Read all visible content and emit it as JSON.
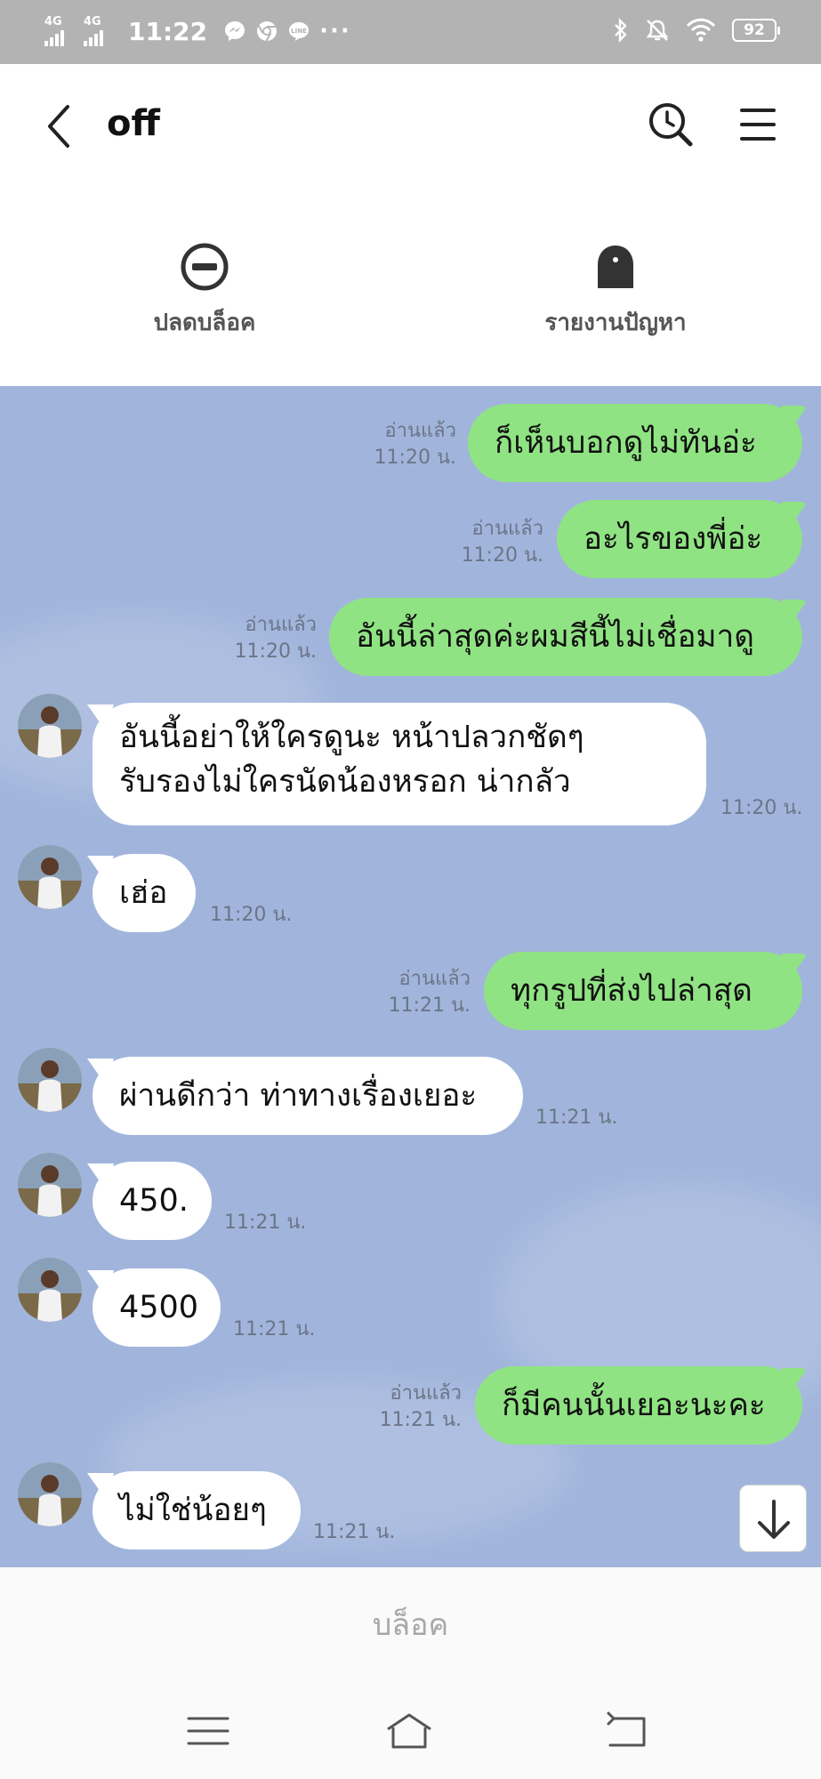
{
  "status_bar": {
    "network_1": "4G",
    "network_2": "4G",
    "time": "11:22",
    "more": "···",
    "battery": "92",
    "icons": [
      "messenger-icon",
      "chrome-icon",
      "line-icon",
      "bluetooth-icon",
      "mute-icon",
      "wifi-icon"
    ]
  },
  "header": {
    "title": "off",
    "back_icon": "chevron-left-icon",
    "search_icon": "search-history-icon",
    "menu_icon": "hamburger-icon"
  },
  "actions": {
    "unblock": "ปลดบล็อค",
    "report": "รายงานปัญหา"
  },
  "messages": [
    {
      "dir": "out",
      "text": "ก็เห็นบอกดูไม่ทันอ่ะ",
      "read": "อ่านแล้ว",
      "time": "11:20 น."
    },
    {
      "dir": "out",
      "text": "อะไรของพี่อ่ะ",
      "read": "อ่านแล้ว",
      "time": "11:20 น."
    },
    {
      "dir": "out",
      "text": "อันนี้ล่าสุดค่ะผมสีนี้ไม่เชื่อมาดู",
      "read": "อ่านแล้ว",
      "time": "11:20 น."
    },
    {
      "dir": "in",
      "lines": [
        "อันนี้อย่าให้ใครดูนะ หน้าปลวกชัดๆ",
        "รับรองไม่ใครนัดน้องหรอก น่ากลัว"
      ],
      "time": "11:20 น."
    },
    {
      "dir": "in",
      "text": "เฮ่อ",
      "time": "11:20 น."
    },
    {
      "dir": "out",
      "text": "ทุกรูปที่ส่งไปล่าสุด",
      "read": "อ่านแล้ว",
      "time": "11:21 น."
    },
    {
      "dir": "in",
      "text": "ผ่านดีกว่า ท่าทางเรื่องเยอะ",
      "time": "11:21 น."
    },
    {
      "dir": "in",
      "text": "450.",
      "time": "11:21 น."
    },
    {
      "dir": "in",
      "text": "4500",
      "time": "11:21 น."
    },
    {
      "dir": "out",
      "text": "ก็มีคนนั้นเยอะนะคะ",
      "read": "อ่านแล้ว",
      "time": "11:21 น."
    },
    {
      "dir": "in",
      "text": "ไม่ใช่น้อยๆ",
      "time": "11:21 น."
    }
  ],
  "bottom": {
    "block_label": "บล็อค"
  },
  "colors": {
    "chat_bg": "#a1b5dc",
    "outgoing_bubble": "#90e383",
    "incoming_bubble": "#ffffff",
    "status_bar": "#b3b3b3"
  }
}
